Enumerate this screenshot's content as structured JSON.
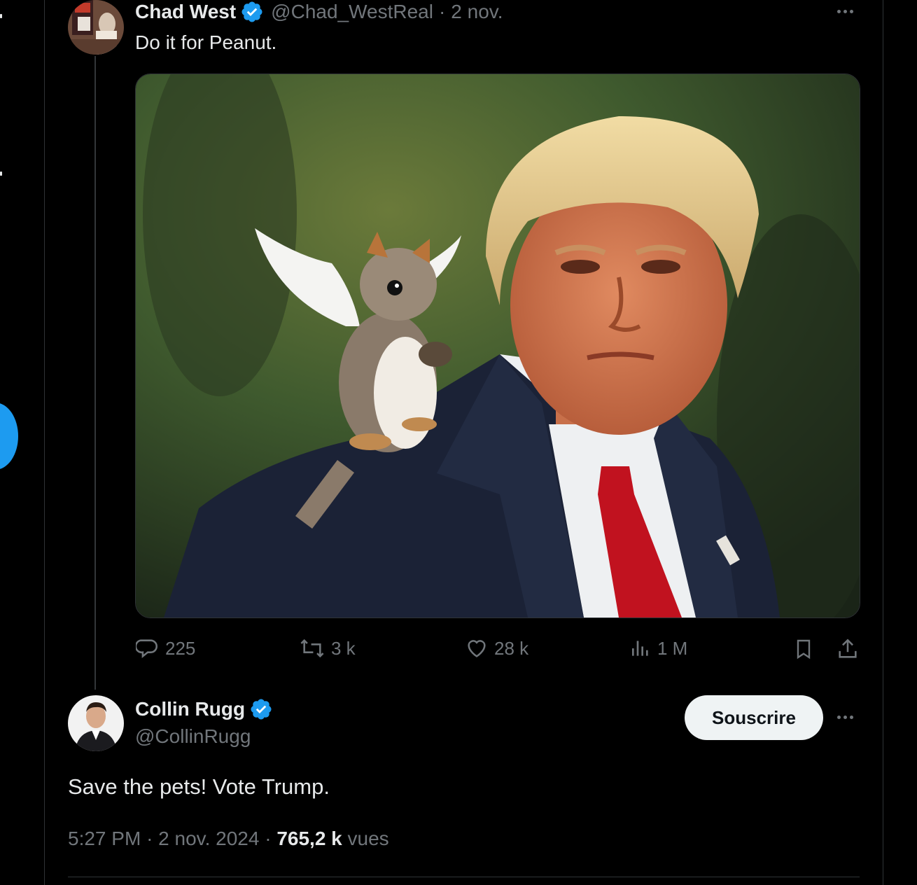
{
  "colors": {
    "background": "#000000",
    "text": "#e7e9ea",
    "muted": "#71767b",
    "accent": "#1d9bf0",
    "verified": "#1d9bf0",
    "button_bg": "#eff3f4"
  },
  "parent_tweet": {
    "author_name": "Chad West",
    "handle": "@Chad_WestReal",
    "separator": "·",
    "date": "2 nov.",
    "text": "Do it for Peanut.",
    "avatar_icon": "avatar-image",
    "media_description_icon": "image-media",
    "actions": {
      "replies": "225",
      "retweets": "3 k",
      "likes": "28 k",
      "views": "1 M"
    }
  },
  "main_tweet": {
    "author_name": "Collin Rugg",
    "handle": "@CollinRugg",
    "subscribe_label": "Souscrire",
    "text": "Save the pets! Vote Trump.",
    "time": "5:27 PM",
    "separator": "·",
    "date": "2 nov. 2024",
    "views_count": "765,2 k",
    "views_label": "vues"
  }
}
